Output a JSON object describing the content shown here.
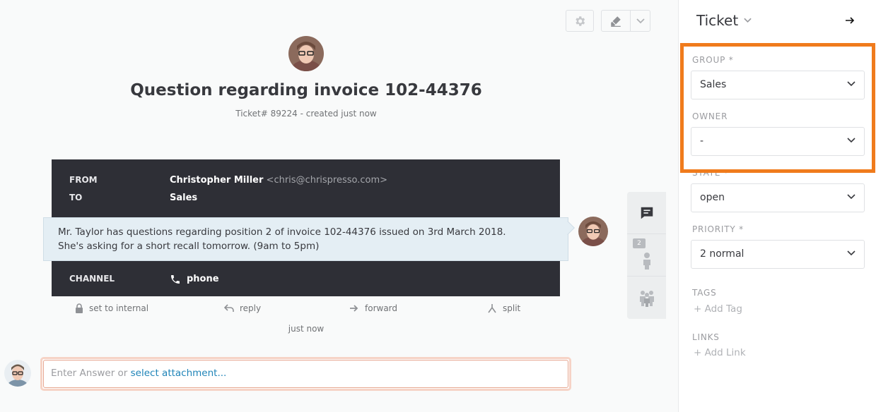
{
  "ticket": {
    "title": "Question regarding invoice 102-44376",
    "meta": "Ticket# 89224 - created just now"
  },
  "article": {
    "from_label": "FROM",
    "from_name": "Christopher Miller",
    "from_email": "<chris@chrispresso.com>",
    "to_label": "TO",
    "to_value": "Sales",
    "body_line1": "Mr. Taylor has questions regarding position 2 of invoice 102-44376 issued on 3rd March 2018.",
    "body_line2": "She's asking for a short recall tomorrow. (9am to 5pm)",
    "channel_label": "CHANNEL",
    "channel_value": "phone",
    "timestamp": "just now"
  },
  "actions": {
    "internal": "set to internal",
    "reply": "reply",
    "forward": "forward",
    "split": "split"
  },
  "reply": {
    "placeholder": "Enter Answer or ",
    "attachment_link": "select attachment..."
  },
  "side_tabs": {
    "customer_badge": "2"
  },
  "sidebar": {
    "title": "Ticket",
    "group_label": "GROUP *",
    "group_value": "Sales",
    "owner_label": "OWNER",
    "owner_value": "-",
    "state_label": "STATE *",
    "state_value": "open",
    "priority_label": "PRIORITY *",
    "priority_value": "2 normal",
    "tags_label": "TAGS",
    "add_tag": "+ Add Tag",
    "links_label": "LINKS",
    "add_link": "+ Add Link"
  },
  "colors": {
    "highlight": "#f07b1c",
    "article_bg": "#2e2f36",
    "link": "#1f84b8"
  }
}
